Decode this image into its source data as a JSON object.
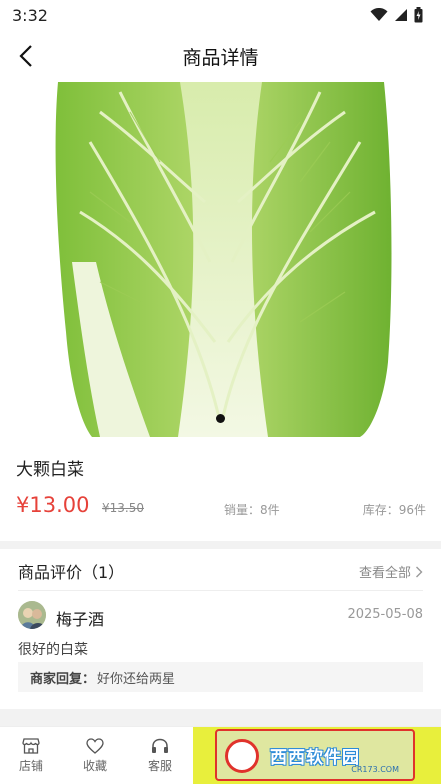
{
  "status_bar": {
    "time": "3:32"
  },
  "header": {
    "title": "商品详情"
  },
  "product": {
    "name": "大颗白菜",
    "price": "¥13.00",
    "original_price": "¥13.50",
    "sales": "销量：8件",
    "stock": "库存：96件"
  },
  "reviews": {
    "title": "商品评价（1）",
    "view_all": "查看全部",
    "items": [
      {
        "user": "梅子酒",
        "date": "2025-05-08",
        "text": "很好的白菜",
        "reply_label": "商家回复：",
        "reply_text": "好你还给两星"
      }
    ]
  },
  "bottom_bar": {
    "tabs": [
      {
        "label": "店铺",
        "icon": "store-icon"
      },
      {
        "label": "收藏",
        "icon": "heart-icon"
      },
      {
        "label": "客服",
        "icon": "headset-icon"
      }
    ]
  },
  "watermark": {
    "text": "西西软件园",
    "url": "CR173.COM"
  },
  "colors": {
    "price": "#e6423a",
    "action_area": "#e8ef3c"
  }
}
